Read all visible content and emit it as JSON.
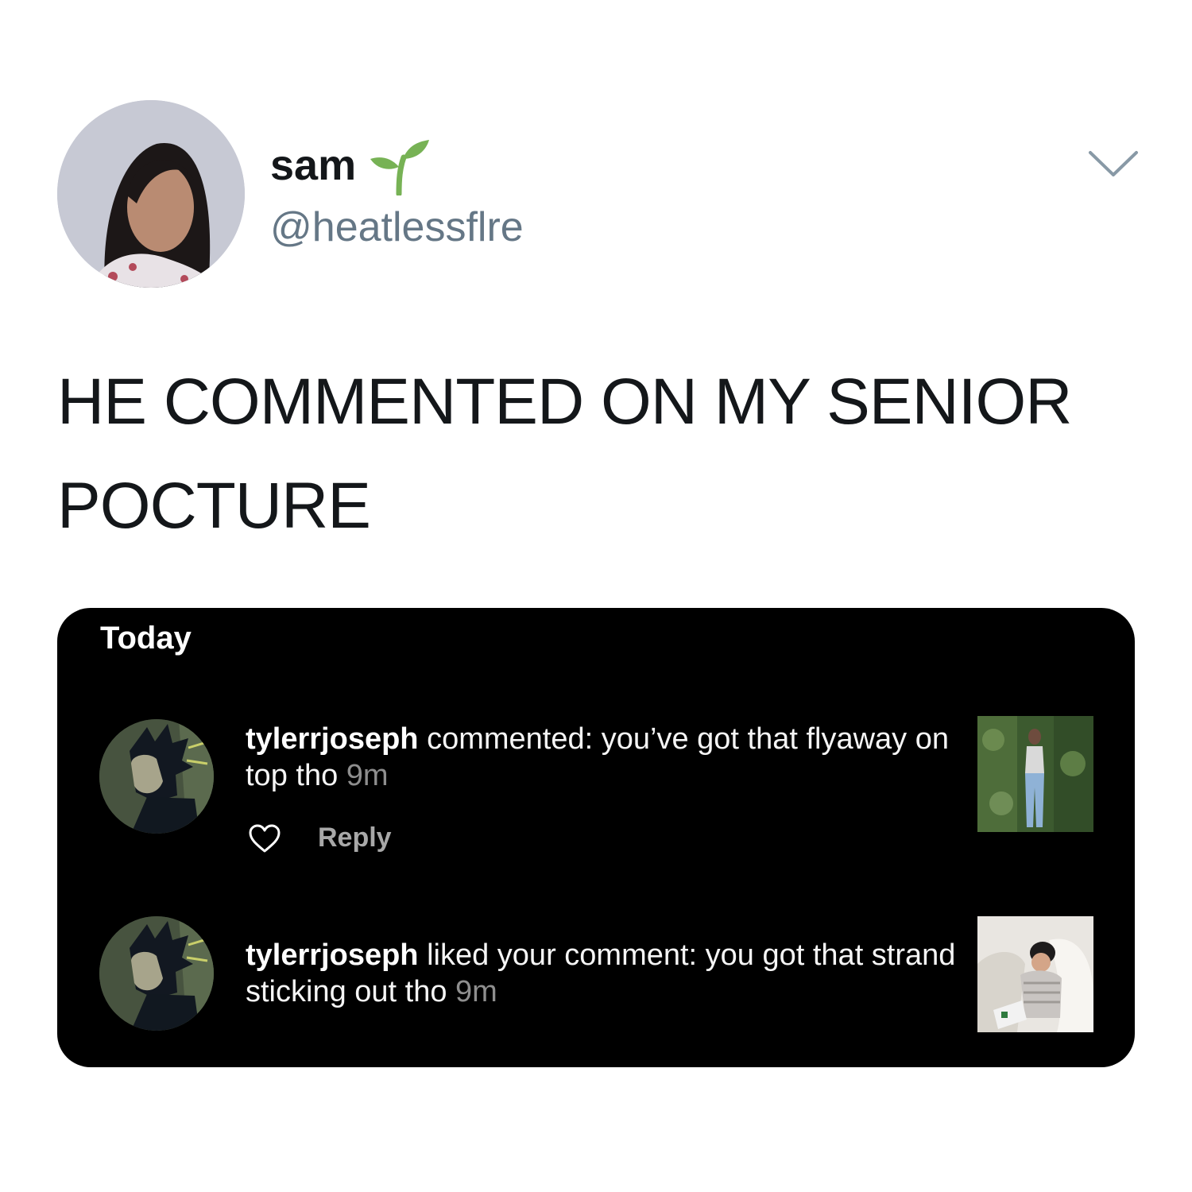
{
  "tweet": {
    "author": {
      "display_name": "sam",
      "emoji": "seedling-emoji",
      "handle": "@heatlessflre"
    },
    "text": "HE COMMENTED ON MY SENIOR POCTURE",
    "menu_icon": "chevron-down-icon"
  },
  "notifications_card": {
    "section_title": "Today",
    "items": [
      {
        "username": "tylerrjoseph",
        "action": " commented: you’ve got that flyaway on top tho ",
        "time": "9m",
        "reply_label": "Reply",
        "like_icon": "heart-icon"
      },
      {
        "username": "tylerrjoseph",
        "action": " liked your comment: you got that strand sticking out tho ",
        "time": "9m"
      }
    ]
  },
  "colors": {
    "card_background": "#000000",
    "handle_gray": "#657786",
    "time_gray": "#8e8e8e",
    "sprout_green": "#77b255"
  }
}
